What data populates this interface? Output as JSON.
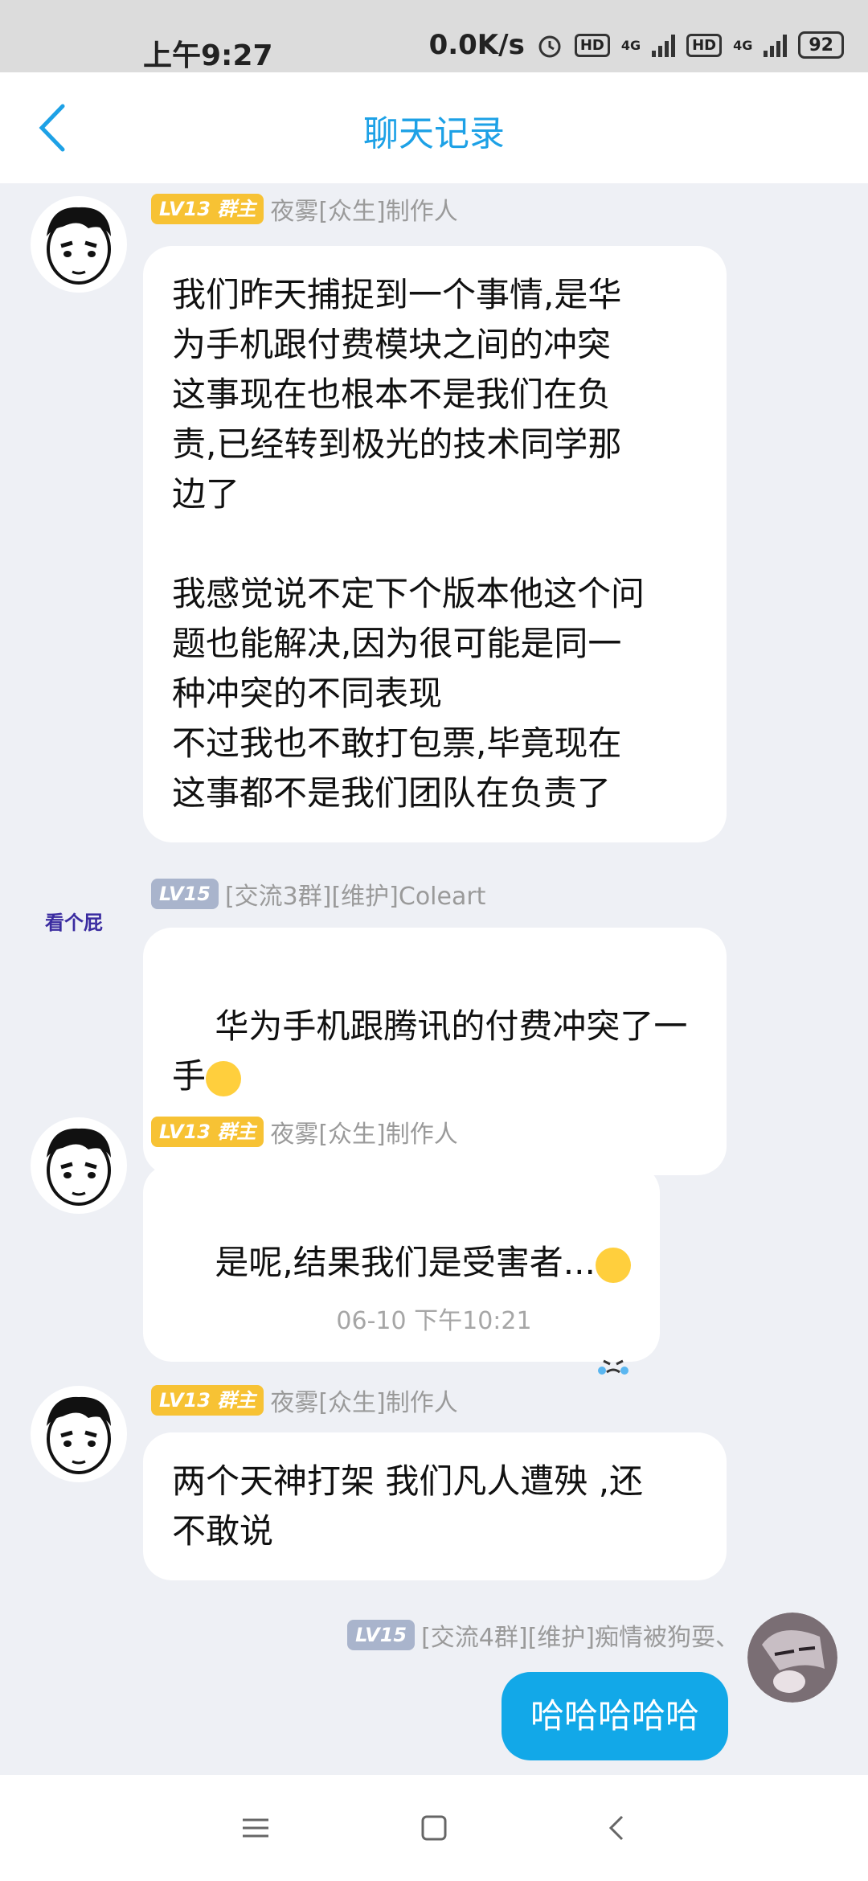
{
  "status_bar": {
    "time": "上午9:27",
    "speed": "0.0K/s",
    "hd1": "HD",
    "net1": "4G",
    "hd2": "HD",
    "net2": "4G",
    "battery": "92"
  },
  "header": {
    "title": "聊天记录"
  },
  "messages": [
    {
      "level": "LV13",
      "role": "群主",
      "name": "夜雾[众生]制作人",
      "text": "我们昨天捕捉到一个事情,是华\n为手机跟付费模块之间的冲突\n这事现在也根本不是我们在负\n责,已经转到极光的技术同学那\n边了\n\n我感觉说不定下个版本他这个问\n题也能解决,因为很可能是同一\n种冲突的不同表现\n不过我也不敢打包票,毕竟现在\n这事都不是我们团队在负责了"
    },
    {
      "level": "LV15",
      "name": "[交流3群][维护]Coleart",
      "avatar_text": "看个屁",
      "text": "华为手机跟腾讯的付费冲突了一\n手"
    },
    {
      "level": "LV13",
      "role": "群主",
      "name": "夜雾[众生]制作人",
      "text": "是呢,结果我们是受害者..."
    },
    {
      "level": "LV13",
      "role": "群主",
      "name": "夜雾[众生]制作人",
      "text": "两个天神打架 我们凡人遭殃 ,还\n不敢说"
    },
    {
      "level": "LV15",
      "name": "[交流4群][维护]痴情被狗耍、",
      "text": "哈哈哈哈哈"
    }
  ],
  "timestamp": "06-10 下午10:21",
  "colors": {
    "accent": "#1DA1E6",
    "my_bubble": "#12A8E8",
    "badge_gold": "#F7C234",
    "badge_gray": "#A9B4CC"
  }
}
